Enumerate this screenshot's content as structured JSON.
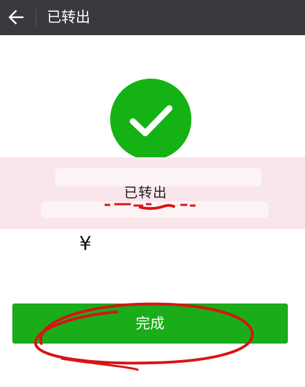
{
  "header": {
    "title": "已转出",
    "back_icon": "arrow-left-icon"
  },
  "result": {
    "icon": "checkmark-icon",
    "icon_color": "#14b214",
    "status": "已转出",
    "amount_currency": "¥"
  },
  "footer": {
    "done_label": "完成",
    "button_color": "#1aad19"
  },
  "colors": {
    "topbar": "#393a3f",
    "highlight_band": "#f9e6ea",
    "annotation_ink": "#d81414"
  }
}
